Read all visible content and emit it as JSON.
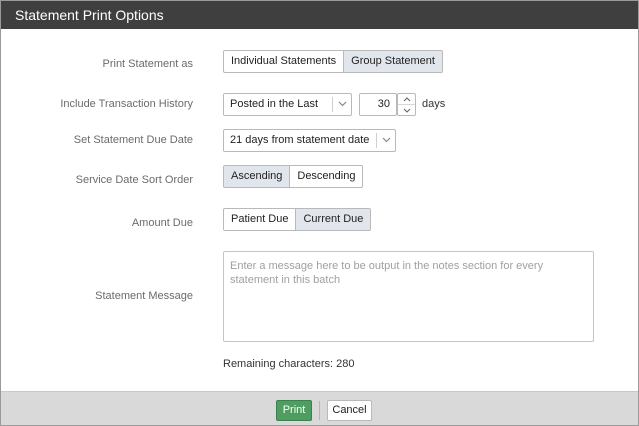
{
  "dialog": {
    "title": "Statement Print Options"
  },
  "print_statement_as": {
    "label": "Print Statement as",
    "options": [
      "Individual Statements",
      "Group Statement"
    ],
    "selected": "Group Statement"
  },
  "transaction_history": {
    "label": "Include Transaction History",
    "select_value": "Posted in the Last",
    "days_value": "30",
    "unit": "days"
  },
  "due_date": {
    "label": "Set Statement Due Date",
    "select_value": "21 days from statement date"
  },
  "sort_order": {
    "label": "Service Date Sort Order",
    "options": [
      "Ascending",
      "Descending"
    ],
    "selected": "Ascending"
  },
  "amount_due": {
    "label": "Amount Due",
    "options": [
      "Patient Due",
      "Current Due"
    ],
    "selected": "Current Due"
  },
  "statement_message": {
    "label": "Statement Message",
    "placeholder": "Enter a message here to be output in the notes section for every statement in this batch",
    "value": "",
    "remaining": "Remaining characters: 280"
  },
  "footer": {
    "print_label": "Print",
    "cancel_label": "Cancel",
    "print_color": "#4f9e61"
  },
  "icons": [
    "chevron-down-icon",
    "chevron-up-icon"
  ]
}
